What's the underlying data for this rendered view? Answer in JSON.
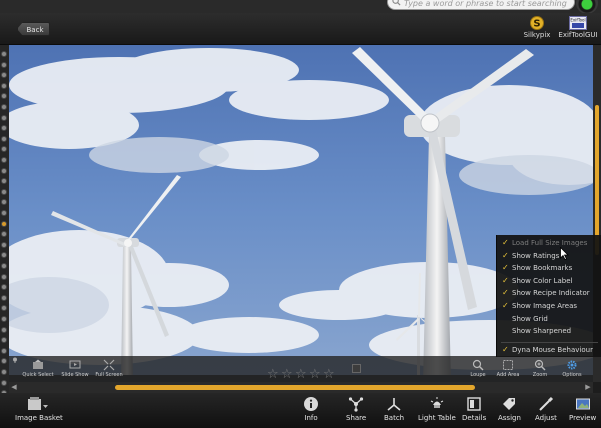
{
  "search": {
    "placeholder": "Type a word or phrase to start searching"
  },
  "header": {
    "back_label": "Back"
  },
  "plugins": [
    {
      "label": "Silkypix",
      "icon": "silkypix-icon"
    },
    {
      "label": "ExifToolGUI",
      "icon": "exiftool-icon",
      "badge": "ExifTool"
    }
  ],
  "overlay_toolbar": {
    "left": [
      {
        "label": "Quick Select",
        "icon": "quick-select-icon"
      },
      {
        "label": "Slide Show",
        "icon": "slide-show-icon"
      },
      {
        "label": "Full Screen",
        "icon": "full-screen-icon"
      }
    ],
    "right": [
      {
        "label": "Loupe",
        "icon": "loupe-icon"
      },
      {
        "label": "Add Area",
        "icon": "add-area-icon"
      },
      {
        "label": "Zoom",
        "icon": "zoom-icon"
      },
      {
        "label": "Options",
        "icon": "options-icon"
      }
    ],
    "rating_stars": 5,
    "rating_value": 0
  },
  "options_menu": {
    "items": [
      {
        "label": "Load Full Size Images",
        "checked": true,
        "highlighted": true
      },
      {
        "label": "Show Ratings",
        "checked": true
      },
      {
        "label": "Show Bookmarks",
        "checked": true
      },
      {
        "label": "Show Color Label",
        "checked": true
      },
      {
        "label": "Show Recipe Indicator",
        "checked": true
      },
      {
        "label": "Show Image Areas",
        "checked": true
      },
      {
        "label": "Show Grid",
        "checked": false
      },
      {
        "label": "Show Sharpened",
        "checked": false
      }
    ],
    "footer_item": {
      "label": "Dyna Mouse Behaviour",
      "checked": true
    }
  },
  "bottom_toolbar": {
    "image_basket": "Image Basket",
    "tools": [
      {
        "label": "Info",
        "icon": "info-icon"
      },
      {
        "label": "Share",
        "icon": "share-icon"
      },
      {
        "label": "Batch",
        "icon": "batch-icon"
      },
      {
        "label": "Light Table",
        "icon": "light-table-icon"
      },
      {
        "label": "Details",
        "icon": "details-icon"
      },
      {
        "label": "Assign",
        "icon": "assign-icon"
      },
      {
        "label": "Adjust",
        "icon": "adjust-icon"
      },
      {
        "label": "Preview",
        "icon": "preview-icon"
      }
    ]
  },
  "colors": {
    "accent": "#e3a62c",
    "check": "#e9c53a",
    "sky": "#5578b6",
    "panel": "#1d1d1d"
  },
  "scroll": {
    "horizontal_thumb_fraction": 0.62,
    "vertical_thumb_fraction": 0.45
  }
}
